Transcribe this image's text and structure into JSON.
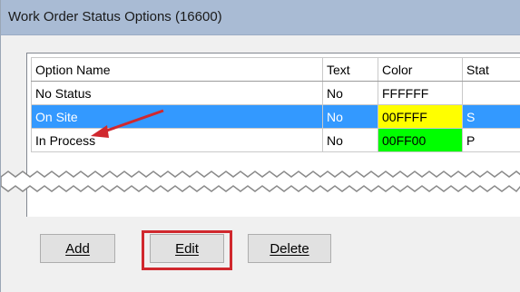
{
  "window": {
    "title": "Work Order Status Options (16600)"
  },
  "grid": {
    "columns": [
      "Option Name",
      "Text",
      "Color",
      "Stat"
    ],
    "rows": [
      {
        "name": "No Status",
        "text": "No",
        "color": "FFFFFF",
        "stat": ""
      },
      {
        "name": "On Site",
        "text": "No",
        "color": "00FFFF",
        "stat": "S"
      },
      {
        "name": "In Process",
        "text": "No",
        "color": "00FF00",
        "stat": "P"
      }
    ]
  },
  "buttons": {
    "add": "Add",
    "edit": "Edit",
    "delete": "Delete"
  },
  "colors": {
    "selection": "#3399ff",
    "on_site_swatch": "#ffff00",
    "in_process_swatch": "#00ff00",
    "callout": "#d0282e"
  }
}
